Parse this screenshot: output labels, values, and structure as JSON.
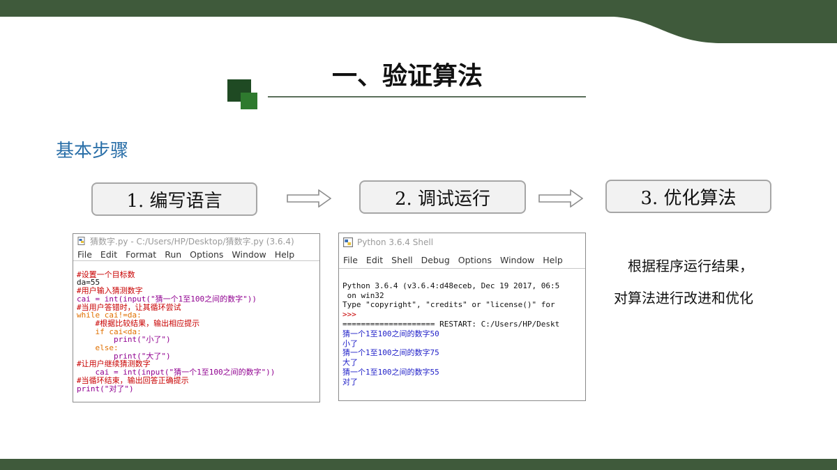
{
  "slide": {
    "title": "一、验证算法",
    "subtitle": "基本步骤",
    "colors": {
      "band": "#3f5a3b",
      "accent_dark": "#1f4a23",
      "accent_light": "#2e7a2e",
      "subtitle": "#2a6fa8"
    },
    "steps": [
      "1. 编写语言",
      "2. 调试运行",
      "3. 优化算法"
    ],
    "note_lines": [
      "根据程序运行结果，",
      "对算法进行改进和优化"
    ]
  },
  "editor": {
    "icon": "python-file-icon",
    "title": "猜数字.py - C:/Users/HP/Desktop/猜数字.py (3.6.4)",
    "menu": [
      "File",
      "Edit",
      "Format",
      "Run",
      "Options",
      "Window",
      "Help"
    ],
    "code_lines": [
      "#设置一个目标数",
      "da=55",
      "#用户输入猜测数字",
      "cai = int(input(\"猜一个1至100之间的数字\"))",
      "#当用户答错时，让其循环尝试",
      "while cai!=da:",
      "    #根据比较结果，输出相应提示",
      "    if cai<da:",
      "        print(\"小了\")",
      "    else:",
      "        print(\"大了\")",
      "#让用户继续猜测数字",
      "    cai = int(input(\"猜一个1至100之间的数字\"))",
      "#当循环结束，输出回答正确提示",
      "print(\"对了\")"
    ]
  },
  "shell": {
    "icon": "python-shell-icon",
    "title": "Python 3.6.4 Shell",
    "menu": [
      "File",
      "Edit",
      "Shell",
      "Debug",
      "Options",
      "Window",
      "Help"
    ],
    "output_lines": [
      "Python 3.6.4 (v3.6.4:d48eceb, Dec 19 2017, 06:5",
      " on win32",
      "Type \"copyright\", \"credits\" or \"license()\" for",
      ">>>",
      "==================== RESTART: C:/Users/HP/Deskt",
      "猜一个1至100之间的数字50",
      "小了",
      "猜一个1至100之间的数字75",
      "大了",
      "猜一个1至100之间的数字55",
      "对了"
    ]
  }
}
